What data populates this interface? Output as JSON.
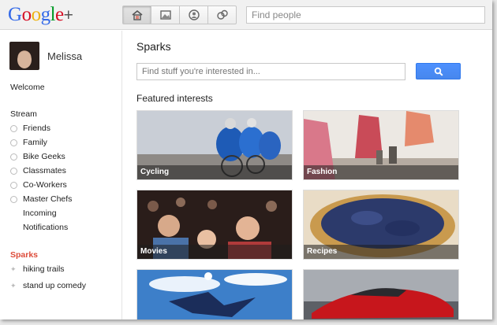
{
  "header": {
    "logo": "Google",
    "logo_plus": "+",
    "search_placeholder": "Find people",
    "nav": [
      "home-icon",
      "photos-icon",
      "profile-icon",
      "circles-icon"
    ]
  },
  "sidebar": {
    "user_name": "Melissa",
    "welcome": "Welcome",
    "stream": "Stream",
    "circles": [
      "Friends",
      "Family",
      "Bike Geeks",
      "Classmates",
      "Co-Workers",
      "Master Chefs"
    ],
    "incoming": "Incoming",
    "notifications": "Notifications",
    "sparks_title": "Sparks",
    "sparks": [
      "hiking trails",
      "stand up comedy"
    ]
  },
  "main": {
    "title": "Sparks",
    "search_placeholder": "Find stuff you're interested in...",
    "featured_title": "Featured interests",
    "tiles": [
      "Cycling",
      "Fashion",
      "Movies",
      "Recipes",
      "",
      ""
    ]
  },
  "colors": {
    "sparks_red": "#dd4b39",
    "button_blue": "#4d90fe",
    "g_blue": "#3369e8",
    "g_red": "#d50f25",
    "g_yellow": "#eeb211",
    "g_green": "#009925"
  }
}
